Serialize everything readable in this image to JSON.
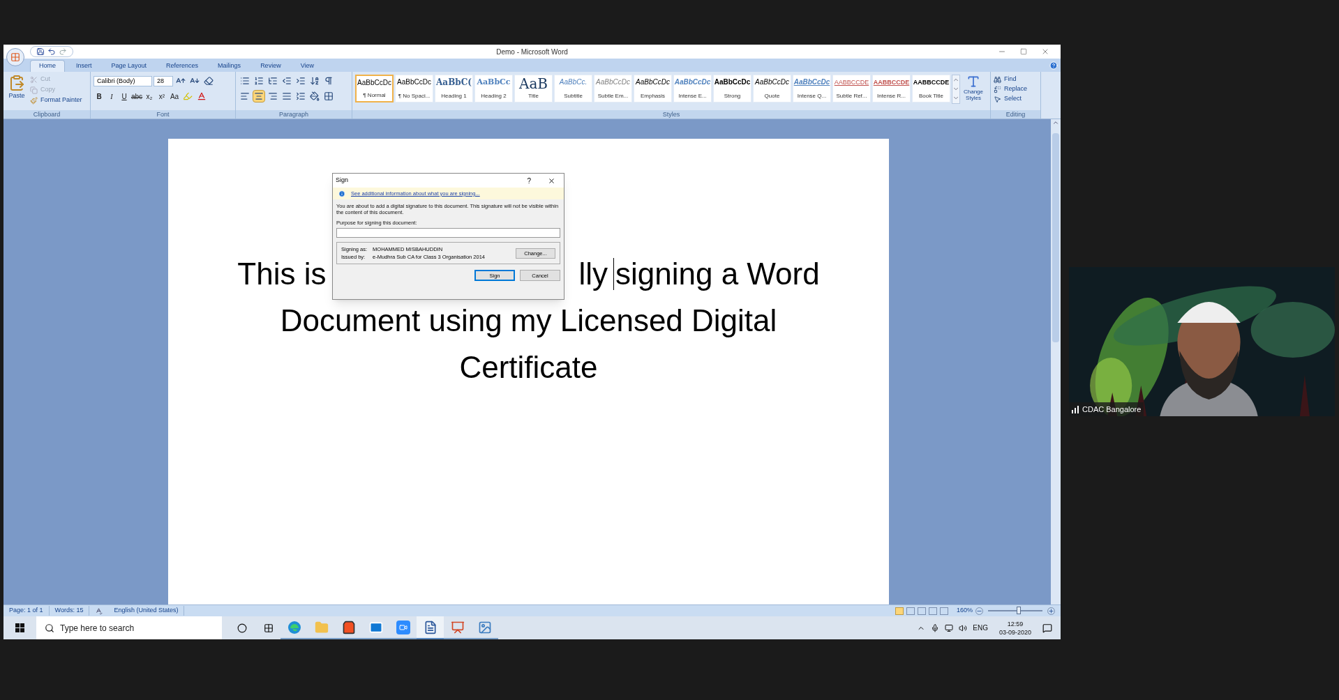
{
  "window": {
    "title": "Demo - Microsoft Word"
  },
  "tabs": [
    {
      "label": "Home",
      "selected": true
    },
    {
      "label": "Insert",
      "selected": false
    },
    {
      "label": "Page Layout",
      "selected": false
    },
    {
      "label": "References",
      "selected": false
    },
    {
      "label": "Mailings",
      "selected": false
    },
    {
      "label": "Review",
      "selected": false
    },
    {
      "label": "View",
      "selected": false
    }
  ],
  "clipboard": {
    "paste": "Paste",
    "items": [
      {
        "kind": "cut",
        "label": "Cut",
        "disabled": true
      },
      {
        "kind": "copy",
        "label": "Copy",
        "disabled": true
      },
      {
        "kind": "painter",
        "label": "Format Painter",
        "disabled": false
      }
    ],
    "group": "Clipboard"
  },
  "font": {
    "name": "Calibri (Body)",
    "size": "28",
    "format_buttons": [
      "B",
      "I",
      "U",
      "abc",
      "x₂",
      "x²",
      "Aa"
    ],
    "group": "Font"
  },
  "paragraph": {
    "alignment": [
      {
        "kind": "left",
        "selected": false
      },
      {
        "kind": "center",
        "selected": true
      },
      {
        "kind": "right",
        "selected": false
      },
      {
        "kind": "justify",
        "selected": false
      }
    ],
    "group": "Paragraph"
  },
  "styles": {
    "items": [
      {
        "kind": "normal",
        "preview": "AaBbCcDc",
        "label": "¶ Normal",
        "selected": true
      },
      {
        "kind": "normal",
        "preview": "AaBbCcDc",
        "label": "¶ No Spaci...",
        "selected": false
      },
      {
        "kind": "heading1",
        "preview": "AaBbC(",
        "label": "Heading 1",
        "selected": false
      },
      {
        "kind": "heading2",
        "preview": "AaBbCc",
        "label": "Heading 2",
        "selected": false
      },
      {
        "kind": "title",
        "preview": "AaB",
        "label": "Title",
        "selected": false
      },
      {
        "kind": "subtitle",
        "preview": "AaBbCc.",
        "label": "Subtitle",
        "selected": false
      },
      {
        "kind": "subtle",
        "preview": "AaBbCcDc",
        "label": "Subtle Em...",
        "selected": false
      },
      {
        "kind": "emphasis",
        "preview": "AaBbCcDc",
        "label": "Emphasis",
        "selected": false
      },
      {
        "kind": "intense",
        "preview": "AaBbCcDc",
        "label": "Intense E...",
        "selected": false
      },
      {
        "kind": "strong",
        "preview": "AaBbCcDc",
        "label": "Strong",
        "selected": false
      },
      {
        "kind": "emphasis",
        "preview": "AaBbCcDc",
        "label": "Quote",
        "selected": false
      },
      {
        "kind": "intensequote",
        "preview": "AaBbCcDc",
        "label": "Intense Q...",
        "selected": false
      },
      {
        "kind": "subtleref",
        "preview": "AABBCCDE",
        "label": "Subtle Ref...",
        "selected": false
      },
      {
        "kind": "intenseref",
        "preview": "AABBCCDE",
        "label": "Intense R...",
        "selected": false
      },
      {
        "kind": "booktitle",
        "preview": "AABBCCDE",
        "label": "Book Title",
        "selected": false
      }
    ],
    "change_styles": [
      "Change",
      "Styles"
    ],
    "group": "Styles"
  },
  "editing": {
    "items": [
      {
        "kind": "find",
        "label": "Find"
      },
      {
        "kind": "replace",
        "label": "Replace"
      },
      {
        "kind": "select",
        "label": "Select"
      }
    ],
    "group": "Editing"
  },
  "document": {
    "lines": [
      [
        {
          "text": "This is",
          "cursor_before": false
        },
        {
          "text": "lly",
          "cursor_before": false
        },
        {
          "text": "signing a Word",
          "cursor_before": true
        }
      ],
      [
        {
          "text": "Document using my Licensed Digital",
          "cursor_before": false
        }
      ],
      [
        {
          "text": "Certificate",
          "cursor_before": false
        }
      ]
    ]
  },
  "dialog": {
    "title": "Sign",
    "help": "?",
    "info_link": "See additional information about what you are signing...",
    "message": "You are about to add a digital signature to this document. This signature will not be visible within the content of this document.",
    "purpose_label": "Purpose for signing this document:",
    "signing_as_label": "Signing as:",
    "signing_as": "MOHAMMED MISBAHUDDIN",
    "issued_by_label": "Issued by:",
    "issued_by": "e-Mudhra Sub CA for Class 3 Organisation 2014",
    "buttons": [
      "Change...",
      "Sign",
      "Cancel"
    ]
  },
  "status_bar": {
    "page": "Page: 1 of 1",
    "words": "Words: 15",
    "language": "English (United States)",
    "zoom": "160%",
    "zoom_slider": {
      "level": 0.56
    }
  },
  "taskbar": {
    "search_placeholder": "Type here to search",
    "apps": [
      {
        "kind": "edge",
        "active": false
      },
      {
        "kind": "explorer",
        "active": false
      },
      {
        "kind": "store",
        "active": false
      },
      {
        "kind": "mail",
        "active": false
      },
      {
        "kind": "zoom",
        "active": false
      },
      {
        "kind": "word",
        "active": true
      },
      {
        "kind": "office",
        "active": false
      },
      {
        "kind": "photos",
        "active": false
      }
    ],
    "language": "ENG",
    "time": "12:59",
    "date": "03-09-2020"
  },
  "video": {
    "name": "CDAC Bangalore"
  }
}
